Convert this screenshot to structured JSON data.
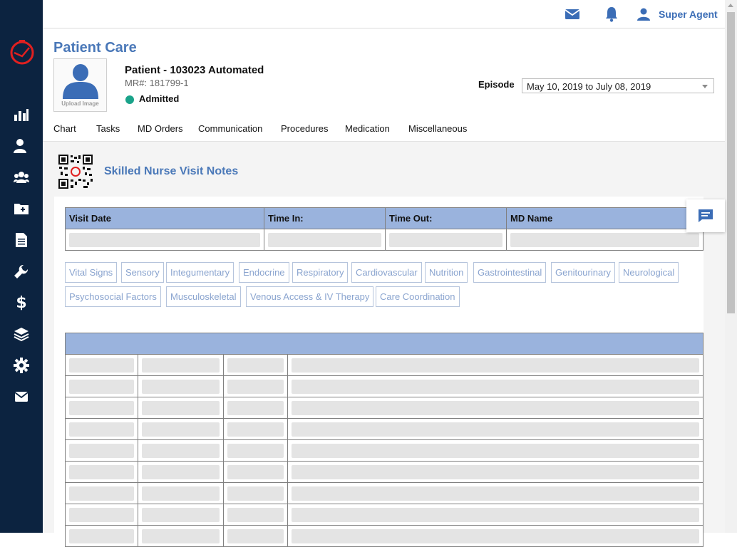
{
  "header": {
    "user_name": "Super Agent"
  },
  "page": {
    "title": "Patient Care"
  },
  "patient": {
    "upload_label": "Upload Image",
    "name": "Patient - 103023 Automated",
    "mr": "MR#: 181799-1",
    "status": "Admitted",
    "status_color": "#1aa38a"
  },
  "episode": {
    "label": "Episode",
    "selected": "May 10, 2019 to July 08, 2019"
  },
  "tabs": [
    {
      "label": "Chart"
    },
    {
      "label": "Tasks"
    },
    {
      "label": "MD Orders"
    },
    {
      "label": "Communication"
    },
    {
      "label": "Procedures"
    },
    {
      "label": "Medication"
    },
    {
      "label": "Miscellaneous"
    }
  ],
  "section": {
    "title": "Skilled Nurse Visit Notes"
  },
  "visit_table": {
    "headers": [
      "Visit Date",
      "Time In:",
      "Time Out:",
      "MD Name"
    ]
  },
  "categories": [
    "Vital Signs",
    "Sensory",
    "Integumentary",
    "Endocrine",
    "Respiratory",
    "Cardiovascular",
    "Nutrition",
    "Gastrointestinal",
    "Genitourinary",
    "Neurological",
    "Psychosocial Factors",
    "Musculoskeletal",
    "Venous Access & IV Therapy",
    "Care Coordination"
  ],
  "colors": {
    "sidebar": "#0c2340",
    "accent": "#4a78b8",
    "table_header": "#9ab3dd",
    "logo": "#e02020"
  },
  "sidebar_icons": [
    "bar-chart-icon",
    "user-add-icon",
    "users-icon",
    "folder-add-icon",
    "document-icon",
    "wrench-icon",
    "dollar-icon",
    "layers-icon",
    "gear-icon",
    "mail-icon"
  ]
}
